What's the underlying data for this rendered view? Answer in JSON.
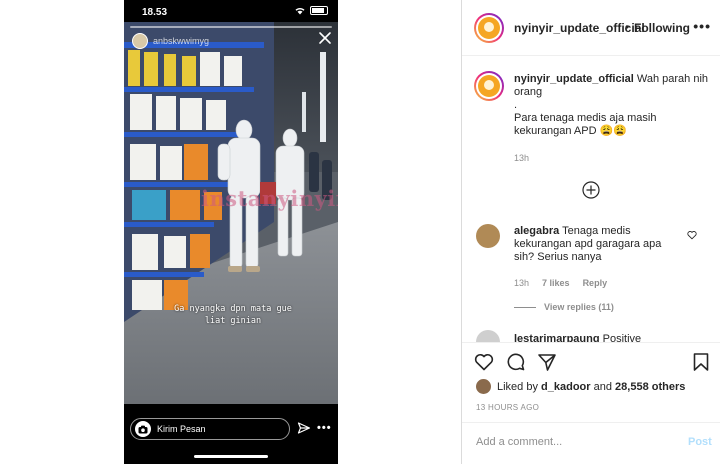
{
  "story": {
    "time": "18.53",
    "username": "anbskwwimyg",
    "watermark": "instanyinyir",
    "caption_line1": "Ga nyangka dpn mata gue",
    "caption_line2": "liat ginian",
    "reply_placeholder": "Kirim Pesan"
  },
  "post": {
    "username": "nyinyir_update_official",
    "separator": "•",
    "follow_status": "Following",
    "caption": {
      "username": "nyinyir_update_official",
      "line1": "Wah parah nih orang",
      "line2": ".",
      "line3": "Para tenaga medis aja masih kekurangan APD 😩😩",
      "time": "13h"
    },
    "comments": [
      {
        "username": "alegabra",
        "text": "Tenaga medis kekurangan apd garagara apa sih? Serius nanya",
        "time": "13h",
        "likes": "7 likes",
        "reply": "Reply",
        "view_replies": "View replies (11)"
      },
      {
        "username": "lestarimarpaung",
        "text": "Positive"
      }
    ],
    "liked_by_prefix": "Liked by",
    "liked_by_user": "d_kadoor",
    "liked_by_and": "and",
    "liked_by_count": "28,558 others",
    "age": "13 HOURS AGO",
    "add_comment_placeholder": "Add a comment...",
    "post_button": "Post"
  },
  "colors": {
    "accent_blue": "#b2dffc",
    "muted_text": "#8e8e8e",
    "primary_text": "#262626",
    "border": "#dbdbdb"
  }
}
